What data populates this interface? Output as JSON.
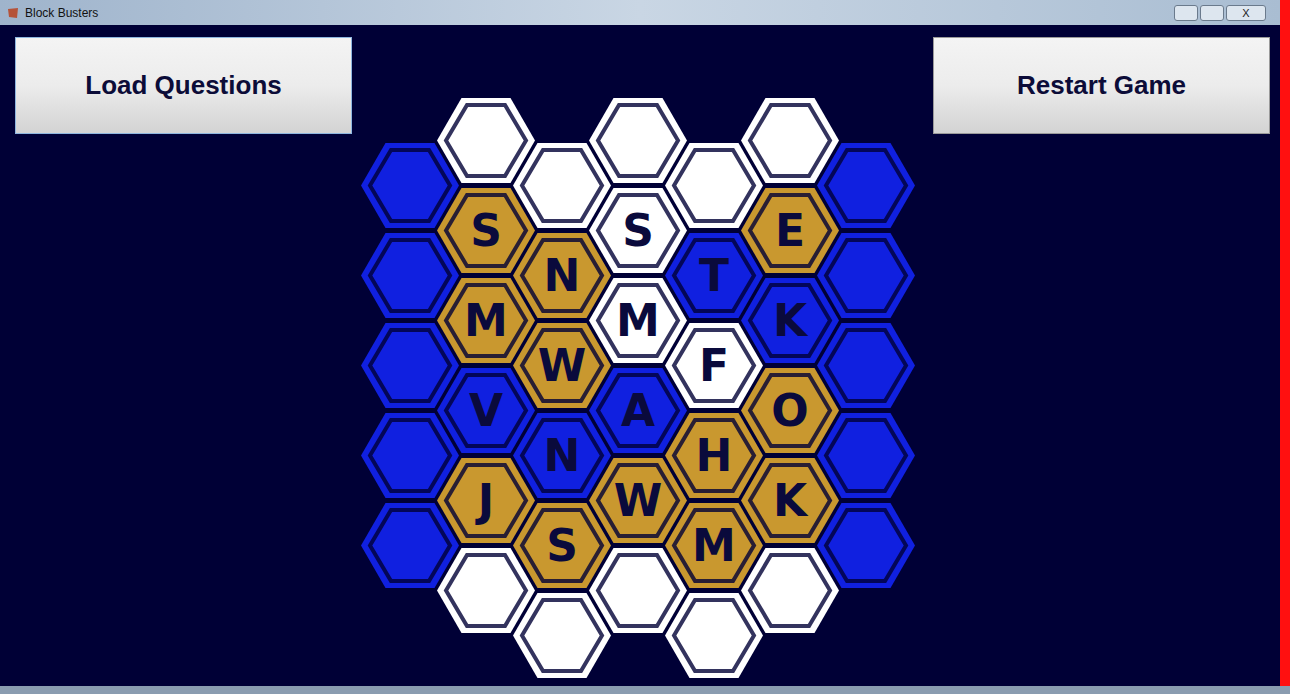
{
  "window": {
    "title": "Block Busters",
    "close": "X"
  },
  "buttons": {
    "load": "Load Questions",
    "restart": "Restart Game"
  },
  "board": {
    "columns": [
      {
        "cells": [
          {
            "letter": "",
            "color": "#1020e0"
          },
          {
            "letter": "",
            "color": "#1020e0"
          },
          {
            "letter": "",
            "color": "#1020e0"
          },
          {
            "letter": "",
            "color": "#1020e0"
          },
          {
            "letter": "",
            "color": "#1020e0"
          }
        ]
      },
      {
        "cells": [
          {
            "letter": "",
            "color": "#ffffff"
          },
          {
            "letter": "S",
            "color": "#c9982f"
          },
          {
            "letter": "M",
            "color": "#c9982f"
          },
          {
            "letter": "V",
            "color": "#1020e0"
          },
          {
            "letter": "J",
            "color": "#c9982f"
          },
          {
            "letter": "",
            "color": "#ffffff"
          }
        ]
      },
      {
        "cells": [
          {
            "letter": "",
            "color": "#ffffff"
          },
          {
            "letter": "N",
            "color": "#c9982f"
          },
          {
            "letter": "W",
            "color": "#c9982f"
          },
          {
            "letter": "N",
            "color": "#1020e0"
          },
          {
            "letter": "S",
            "color": "#c9982f"
          },
          {
            "letter": "",
            "color": "#ffffff"
          }
        ]
      },
      {
        "cells": [
          {
            "letter": "",
            "color": "#ffffff"
          },
          {
            "letter": "S",
            "color": "#ffffff"
          },
          {
            "letter": "M",
            "color": "#ffffff"
          },
          {
            "letter": "A",
            "color": "#1020e0"
          },
          {
            "letter": "W",
            "color": "#c9982f"
          },
          {
            "letter": "",
            "color": "#ffffff"
          }
        ]
      },
      {
        "cells": [
          {
            "letter": "",
            "color": "#ffffff"
          },
          {
            "letter": "T",
            "color": "#1020e0"
          },
          {
            "letter": "F",
            "color": "#ffffff"
          },
          {
            "letter": "H",
            "color": "#c9982f"
          },
          {
            "letter": "M",
            "color": "#c9982f"
          },
          {
            "letter": "",
            "color": "#ffffff"
          }
        ]
      },
      {
        "cells": [
          {
            "letter": "",
            "color": "#ffffff"
          },
          {
            "letter": "E",
            "color": "#c9982f"
          },
          {
            "letter": "K",
            "color": "#1020e0"
          },
          {
            "letter": "O",
            "color": "#c9982f"
          },
          {
            "letter": "K",
            "color": "#c9982f"
          },
          {
            "letter": "",
            "color": "#ffffff"
          }
        ]
      },
      {
        "cells": [
          {
            "letter": "",
            "color": "#1020e0"
          },
          {
            "letter": "",
            "color": "#1020e0"
          },
          {
            "letter": "",
            "color": "#1020e0"
          },
          {
            "letter": "",
            "color": "#1020e0"
          },
          {
            "letter": "",
            "color": "#1020e0"
          }
        ]
      }
    ]
  }
}
